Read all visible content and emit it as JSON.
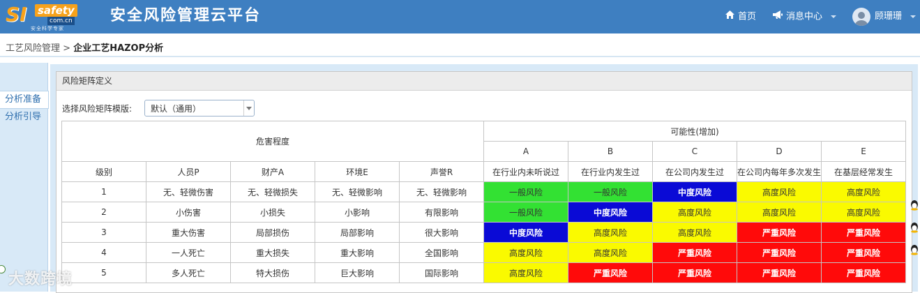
{
  "header": {
    "logo_si": "SI",
    "logo_safety": "safety",
    "logo_url": "com.cn",
    "logo_sub": "安全科学专家",
    "title": "安全风险管理云平台",
    "home": "首页",
    "messages": "消息中心",
    "user": "顾珊珊",
    "accent": "#3e7fc1"
  },
  "breadcrumb": {
    "parent": "工艺风险管理",
    "sep": " > ",
    "current": "企业工艺HAZOP分析"
  },
  "sidebar": {
    "items": [
      {
        "label": "分析准备"
      },
      {
        "label": "分析引导"
      }
    ]
  },
  "panel": {
    "title": "风险矩阵定义",
    "template_label": "选择风险矩阵模版:",
    "template_value": "默认（通用）"
  },
  "matrix": {
    "severity_header": "危害程度",
    "likelihood_header": "可能性(增加)",
    "columns": [
      "级别",
      "人员P",
      "财产A",
      "环境E",
      "声誉R"
    ],
    "likelihood_letters": [
      "A",
      "B",
      "C",
      "D",
      "E"
    ],
    "likelihood_desc": [
      "在行业内未听说过",
      "在行业内发生过",
      "在公司内发生过",
      "在公司内每年多次发生",
      "在基层经常发生"
    ],
    "rows": [
      {
        "level": "1",
        "p": "无、轻微伤害",
        "a": "无、轻微损失",
        "e": "无、轻微影响",
        "r": "无、轻微影响",
        "cells": [
          {
            "t": "一般风险",
            "c": "green"
          },
          {
            "t": "一般风险",
            "c": "green"
          },
          {
            "t": "中度风险",
            "c": "blue"
          },
          {
            "t": "高度风险",
            "c": "yellow"
          },
          {
            "t": "高度风险",
            "c": "yellow"
          }
        ]
      },
      {
        "level": "2",
        "p": "小伤害",
        "a": "小损失",
        "e": "小影响",
        "r": "有限影响",
        "cells": [
          {
            "t": "一般风险",
            "c": "green"
          },
          {
            "t": "中度风险",
            "c": "blue"
          },
          {
            "t": "高度风险",
            "c": "yellow"
          },
          {
            "t": "高度风险",
            "c": "yellow"
          },
          {
            "t": "高度风险",
            "c": "yellow"
          }
        ]
      },
      {
        "level": "3",
        "p": "重大伤害",
        "a": "局部损伤",
        "e": "局部影响",
        "r": "很大影响",
        "cells": [
          {
            "t": "中度风险",
            "c": "blue"
          },
          {
            "t": "高度风险",
            "c": "yellow"
          },
          {
            "t": "高度风险",
            "c": "yellow"
          },
          {
            "t": "严重风险",
            "c": "red"
          },
          {
            "t": "严重风险",
            "c": "red"
          }
        ]
      },
      {
        "level": "4",
        "p": "一人死亡",
        "a": "重大损失",
        "e": "重大影响",
        "r": "全国影响",
        "cells": [
          {
            "t": "高度风险",
            "c": "yellow"
          },
          {
            "t": "高度风险",
            "c": "yellow"
          },
          {
            "t": "严重风险",
            "c": "red"
          },
          {
            "t": "严重风险",
            "c": "red"
          },
          {
            "t": "严重风险",
            "c": "red"
          }
        ]
      },
      {
        "level": "5",
        "p": "多人死亡",
        "a": "特大损伤",
        "e": "巨大影响",
        "r": "国际影响",
        "cells": [
          {
            "t": "高度风险",
            "c": "yellow"
          },
          {
            "t": "严重风险",
            "c": "red"
          },
          {
            "t": "严重风险",
            "c": "red"
          },
          {
            "t": "严重风险",
            "c": "red"
          },
          {
            "t": "严重风险",
            "c": "red"
          }
        ]
      }
    ],
    "colors": {
      "green": "#33e133",
      "blue": "#0a0ad6",
      "yellow": "#fafa00",
      "red": "#ff0a0a"
    }
  },
  "watermark": "大数跨境"
}
